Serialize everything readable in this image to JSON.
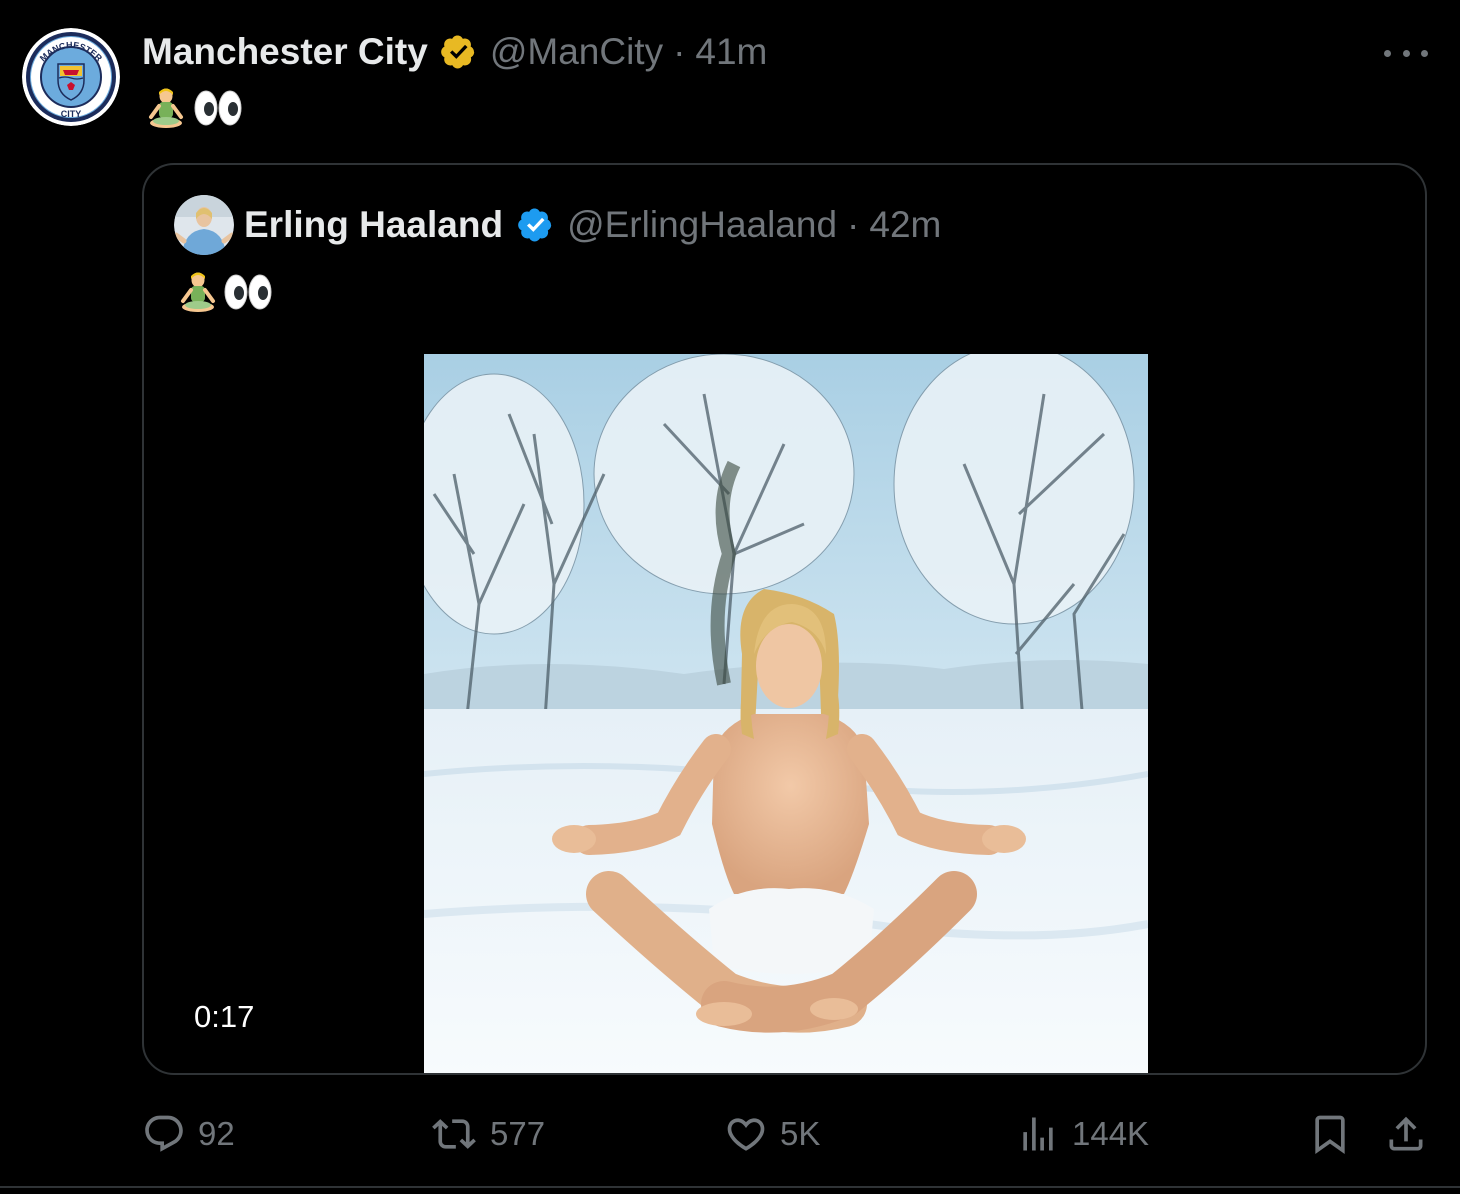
{
  "tweet": {
    "author": {
      "display_name": "Manchester City",
      "handle": "@ManCity",
      "separator": "·",
      "time": "41m",
      "verified_color": "#e8b923"
    },
    "text_emoji": [
      "person-in-lotus-position-emoji",
      "eyes-emoji"
    ],
    "quote": {
      "author": {
        "display_name": "Erling Haaland",
        "handle": "@ErlingHaaland",
        "separator": "·",
        "time": "42m",
        "verified_color": "#1d9bf0"
      },
      "text_emoji": [
        "person-in-lotus-position-emoji",
        "eyes-emoji"
      ],
      "video": {
        "duration": "0:17"
      }
    },
    "actions": {
      "replies": "92",
      "reposts": "577",
      "likes": "5K",
      "views": "144K"
    }
  },
  "colors": {
    "background": "#000000",
    "text_primary": "#e7e9ea",
    "text_secondary": "#71767b",
    "border": "#2f3336"
  }
}
